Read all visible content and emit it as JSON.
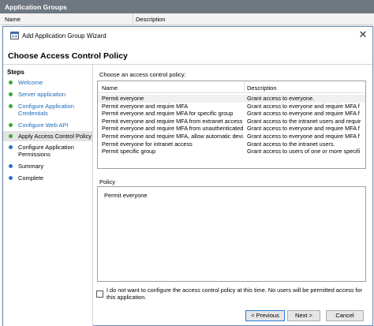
{
  "outer": {
    "title": "Application Groups",
    "col_name": "Name",
    "col_description": "Description"
  },
  "wizard": {
    "title": "Add Application Group Wizard",
    "page_title": "Choose Access Control Policy",
    "close_glyph": "✕"
  },
  "steps": {
    "heading": "Steps",
    "items": [
      {
        "label": "Welcome",
        "state": "done"
      },
      {
        "label": "Server application",
        "state": "done"
      },
      {
        "label": "Configure Application Credentials",
        "state": "done"
      },
      {
        "label": "Configure Web API",
        "state": "done"
      },
      {
        "label": "Apply Access Control Policy",
        "state": "current"
      },
      {
        "label": "Configure Application Permissions",
        "state": "pending"
      },
      {
        "label": "Summary",
        "state": "pending"
      },
      {
        "label": "Complete",
        "state": "pending"
      }
    ]
  },
  "policy_list": {
    "label": "Choose an access control policy:",
    "col_name": "Name",
    "col_description": "Description",
    "rows": [
      {
        "name": "Permit everyone",
        "description": "Grant access to everyone."
      },
      {
        "name": "Permit everyone and require MFA",
        "description": "Grant access to everyone and require MFA f"
      },
      {
        "name": "Permit everyone and require MFA for specific group",
        "description": "Grant access to everyone and require MFA f"
      },
      {
        "name": "Permit everyone and require MFA from extranet access",
        "description": "Grant access to the intranet users and requir"
      },
      {
        "name": "Permit everyone and require MFA from unauthenticated ...",
        "description": "Grant access to everyone and require MFA f"
      },
      {
        "name": "Permit everyone and require MFA, allow automatic devi...",
        "description": "Grant access to everyone and require MFA f"
      },
      {
        "name": "Permit everyone for intranet access",
        "description": "Grant access to the intranet users."
      },
      {
        "name": "Permit specific group",
        "description": "Grant access to users of one or more specifi"
      }
    ]
  },
  "policy_detail": {
    "label": "Policy",
    "text": "Permit everyone"
  },
  "skip_option": {
    "label": "I do not want to configure the access control policy at this time.  No users will be permitted access for this application.",
    "checked": false
  },
  "buttons": {
    "previous": "< Previous",
    "next": "Next >",
    "cancel": "Cancel"
  },
  "colors": {
    "done_dot": "#3aa63a",
    "pending_dot": "#2e6fc2",
    "link": "#1f6ab5"
  }
}
